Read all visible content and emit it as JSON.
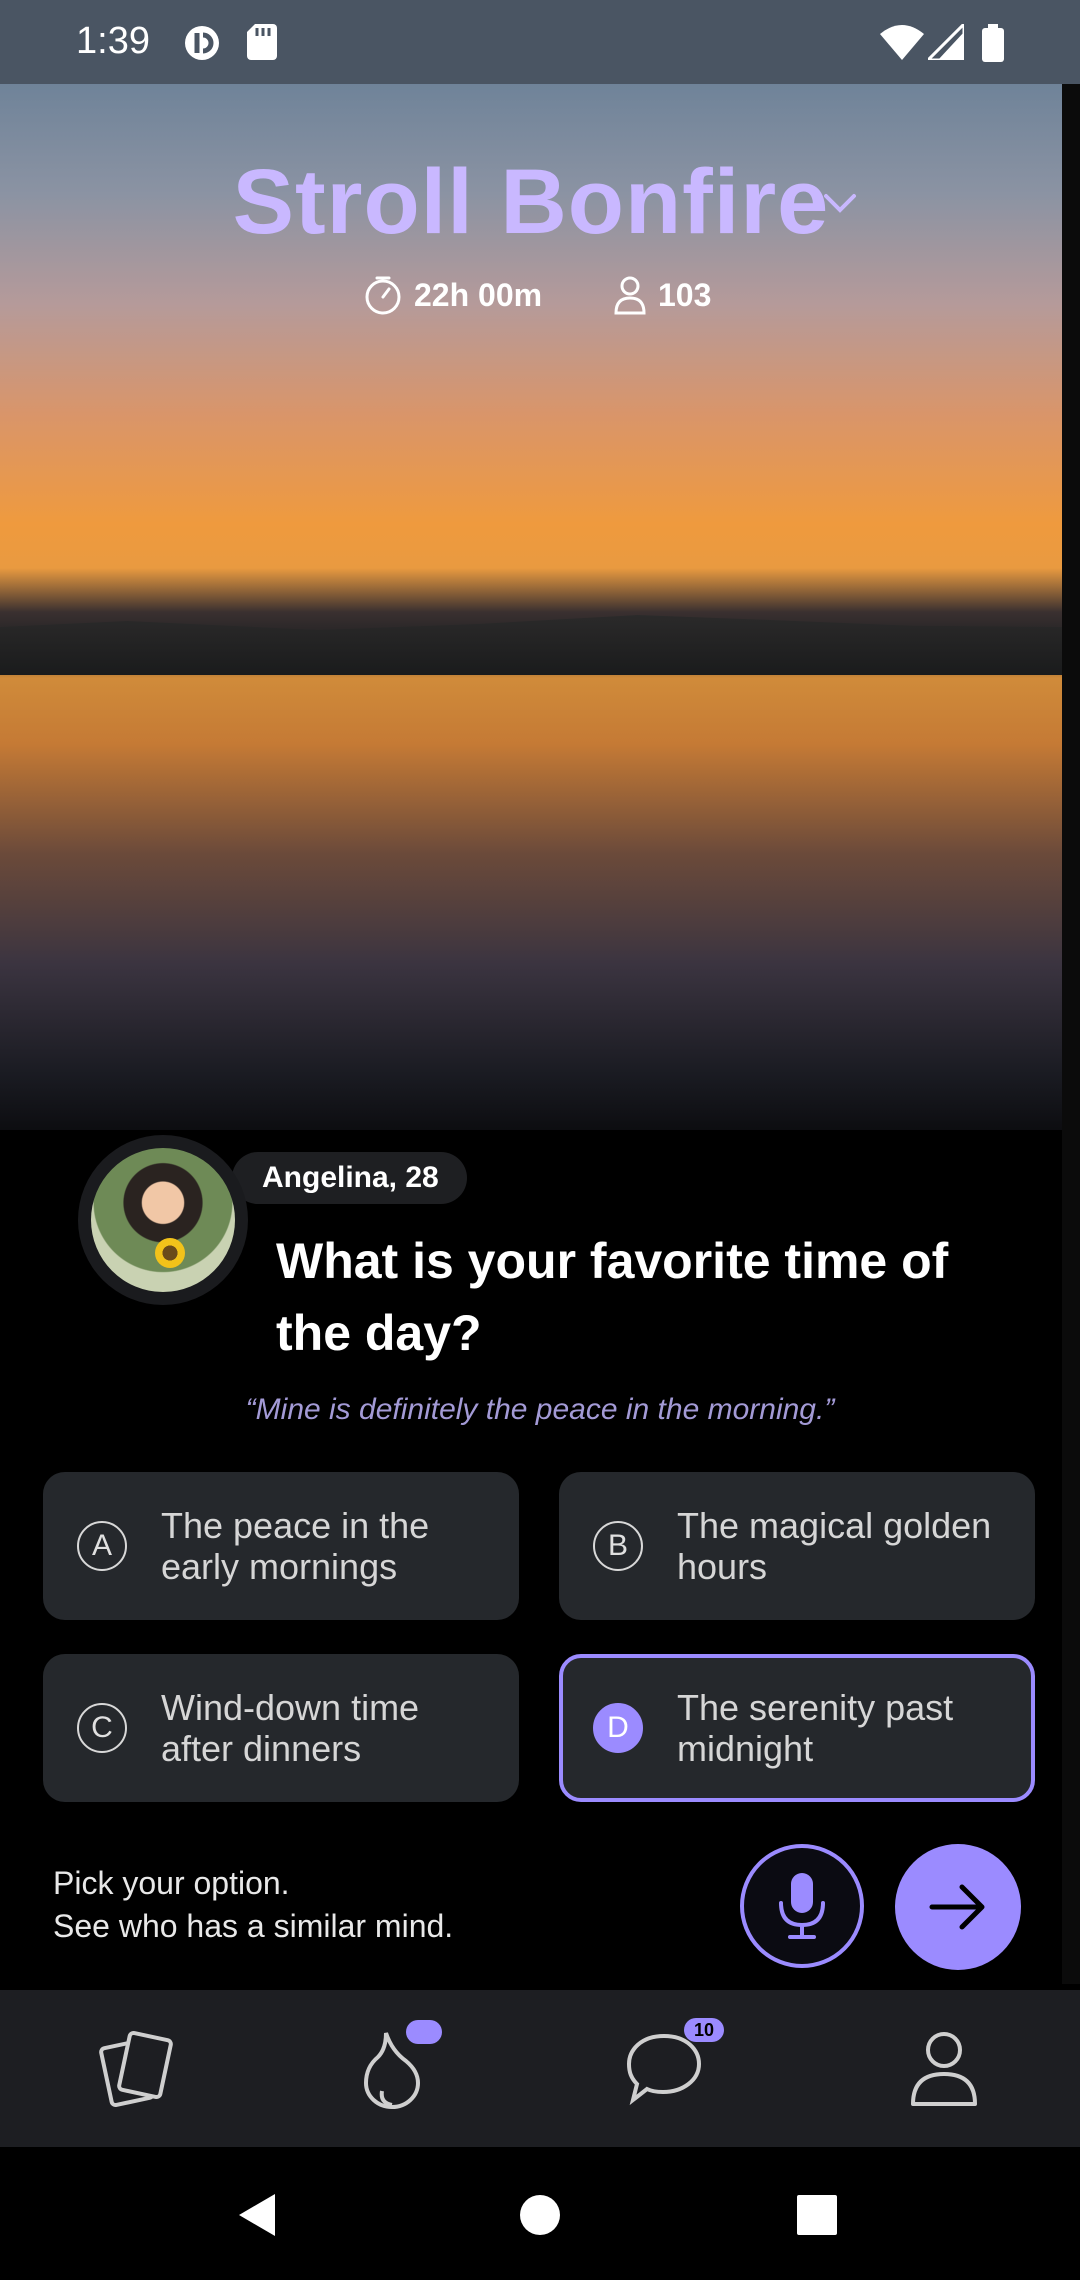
{
  "status_bar": {
    "time": "1:39"
  },
  "room": {
    "title": "Stroll Bonfire",
    "timer": "22h 00m",
    "participants": "103"
  },
  "prompt": {
    "author": "Angelina, 28",
    "question": "What is your favorite time of the day?",
    "quote": "“Mine is definitely the peace in the morning.”"
  },
  "options": [
    {
      "letter": "A",
      "text": "The peace in the early mornings"
    },
    {
      "letter": "B",
      "text": "The magical golden hours"
    },
    {
      "letter": "C",
      "text": "Wind-down time after dinners"
    },
    {
      "letter": "D",
      "text": "The serenity past midnight",
      "selected": true
    }
  ],
  "hint": {
    "line1": "Pick your option.",
    "line2": "See who has a similar mind."
  },
  "tabs": {
    "chat_badge": "10",
    "items": [
      "cards-icon",
      "bonfire-icon",
      "chat-icon",
      "profile-icon"
    ]
  },
  "colors": {
    "accent": "#9b8bff",
    "title": "#c9b8ff",
    "card": "#25282c"
  }
}
